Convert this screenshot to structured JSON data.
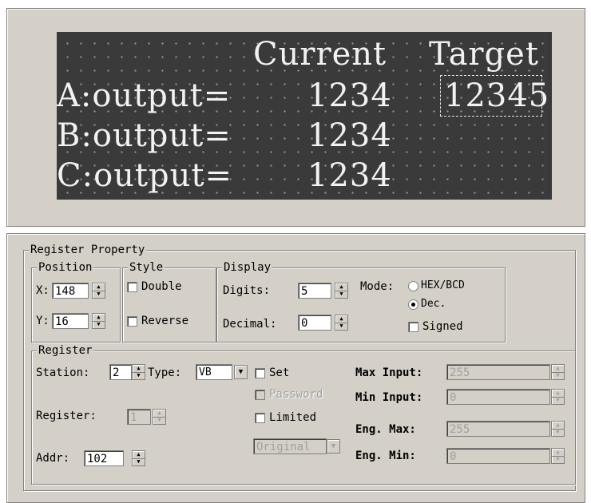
{
  "preview": {
    "header_current": "Current",
    "header_target": "Target",
    "rows": [
      {
        "label": "A:output=",
        "current": "1234",
        "target": "12345"
      },
      {
        "label": "B:output=",
        "current": "1234",
        "target": ""
      },
      {
        "label": "C:output=",
        "current": "1234",
        "target": ""
      }
    ]
  },
  "register_property": {
    "title": "Register Property",
    "position": {
      "legend": "Position",
      "x_label": "X:",
      "x_value": "148",
      "y_label": "Y:",
      "y_value": "16"
    },
    "style": {
      "legend": "Style",
      "double_label": "Double",
      "double_checked": false,
      "reverse_label": "Reverse",
      "reverse_checked": false
    },
    "display": {
      "legend": "Display",
      "digits_label": "Digits:",
      "digits_value": "5",
      "decimal_label": "Decimal:",
      "decimal_value": "0",
      "mode_label": "Mode:",
      "mode_options": [
        "HEX/BCD",
        "Dec."
      ],
      "mode_selected": "Dec.",
      "signed_label": "Signed",
      "signed_checked": false
    },
    "register": {
      "legend": "Register",
      "station_label": "Station:",
      "station_value": "2",
      "type_label": "Type:",
      "type_value": "VB",
      "set_label": "Set",
      "set_checked": false,
      "password_label": "Password",
      "limited_label": "Limited",
      "limited_checked": false,
      "original_value": "Original",
      "register_label": "Register:",
      "register_value": "1",
      "addr_label": "Addr:",
      "addr_value": "102",
      "max_input_label": "Max Input:",
      "max_input_value": "255",
      "min_input_label": "Min Input:",
      "min_input_value": "0",
      "eng_max_label": "Eng. Max:",
      "eng_max_value": "255",
      "eng_min_label": "Eng. Min:",
      "eng_min_value": "0"
    }
  },
  "icons": {
    "spin_up": "▲",
    "spin_down": "▼",
    "dropdown": "▼"
  }
}
